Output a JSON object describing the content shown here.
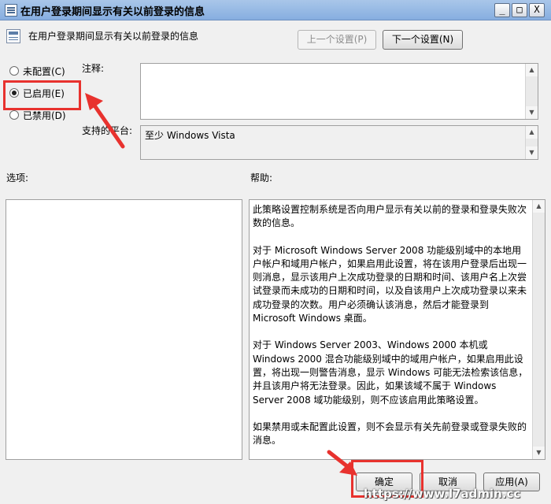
{
  "window": {
    "title": "在用户登录期间显示有关以前登录的信息",
    "controls": {
      "minimize": "_",
      "maximize": "□",
      "close": "X"
    }
  },
  "header": {
    "policy_title": "在用户登录期间显示有关以前登录的信息",
    "prev_button": "上一个设置(P)",
    "next_button": "下一个设置(N)"
  },
  "options": {
    "not_configured": "未配置(C)",
    "enabled": "已启用(E)",
    "disabled": "已禁用(D)",
    "selected": "enabled"
  },
  "comment": {
    "label": "注释:",
    "value": ""
  },
  "supported": {
    "label": "支持的平台:",
    "value": "至少 Windows Vista"
  },
  "panes": {
    "options_label": "选项:",
    "help_label": "帮助:"
  },
  "help": {
    "paragraphs": [
      "此策略设置控制系统是否向用户显示有关以前的登录和登录失败次数的信息。",
      "对于 Microsoft Windows Server 2008 功能级别域中的本地用户帐户和域用户帐户，如果启用此设置，将在该用户登录后出现一则消息，显示该用户上次成功登录的日期和时间、该用户名上次尝试登录而未成功的日期和时间，以及自该用户上次成功登录以来未成功登录的次数。用户必须确认该消息，然后才能登录到 Microsoft Windows 桌面。",
      "对于 Windows Server 2003、Windows 2000 本机或 Windows 2000 混合功能级别域中的域用户帐户，如果启用此设置，将出现一则警告消息，显示 Windows 可能无法检索该信息，并且该用户将无法登录。因此，如果该域不属于 Windows Server 2008 域功能级别，则不应该启用此策略设置。",
      "如果禁用或未配置此设置，则不会显示有关先前登录或登录失败的消息。"
    ]
  },
  "footer": {
    "ok_button": "确定",
    "cancel_button": "取消",
    "apply_button": "应用(A)"
  },
  "watermark": "https://www.l7admin.cc",
  "colors": {
    "annotation_red": "#e8322e",
    "titlebar": "#a9c6e9"
  }
}
